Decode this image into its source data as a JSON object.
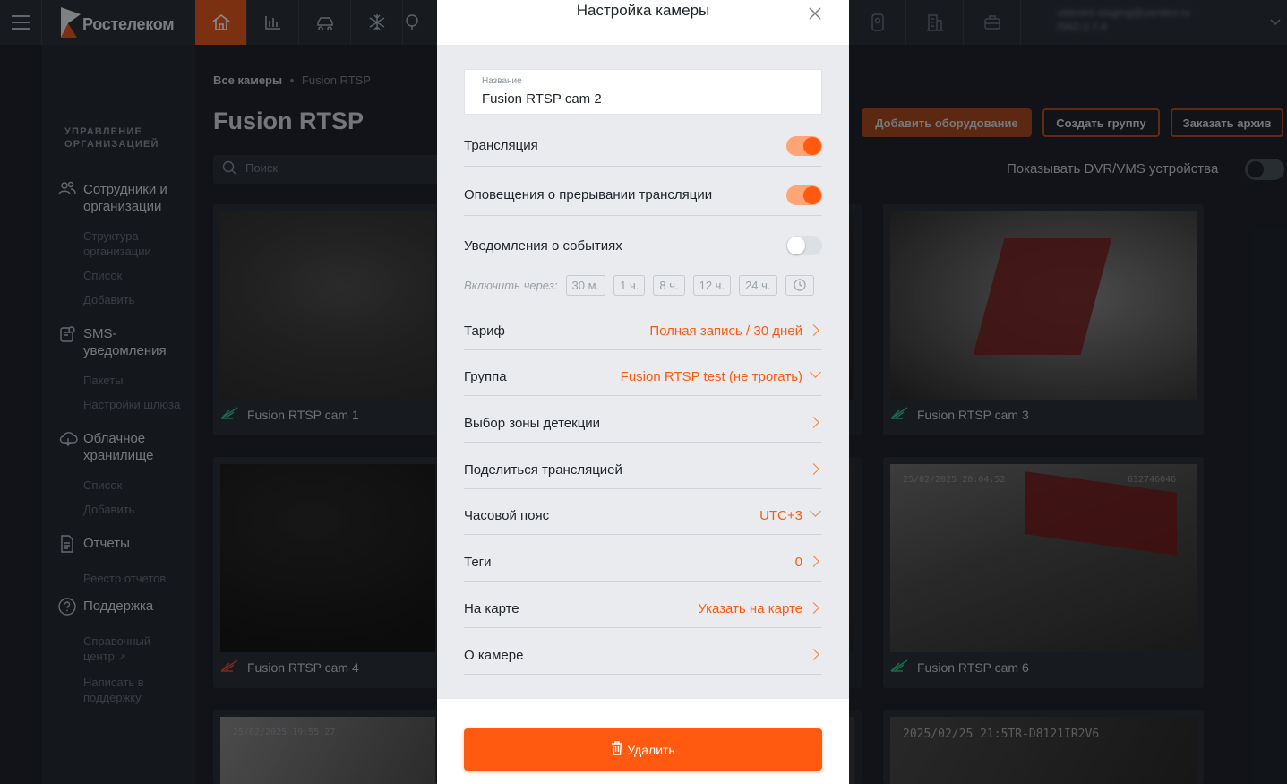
{
  "topbar": {
    "brand": "Ростелеком",
    "nav_icons": [
      "home-icon",
      "chart-icon",
      "car-icon",
      "snowflake-icon",
      "tree-icon"
    ],
    "nav_right_icons": [
      "doorbell-icon",
      "building-icon",
      "briefcase-icon"
    ],
    "user_email": "videoint-staging@yandex.ru",
    "user_sub": "ПАО 2.7.4"
  },
  "sidebar": {
    "section_title": "УПРАВЛЕНИЕ ОРГАНИЗАЦИЕЙ",
    "groups": [
      {
        "label": "Сотрудники и организации",
        "icon": "users-icon",
        "items": [
          "Структура организации",
          "Список",
          "Добавить"
        ]
      },
      {
        "label": "SMS-уведомления",
        "icon": "sms-icon",
        "items": [
          "Пакеты",
          "Настройки шлюза"
        ]
      },
      {
        "label": "Облачное хранилище",
        "icon": "cloud-icon",
        "items": [
          "Список",
          "Добавить"
        ]
      },
      {
        "label": "Отчеты",
        "icon": "report-icon",
        "items": [
          "Реестр отчетов"
        ]
      },
      {
        "label": "Поддержка",
        "icon": "help-icon",
        "items": [
          "Справочный центр",
          "Написать в поддержку"
        ]
      }
    ]
  },
  "main": {
    "breadcrumb_all": "Все камеры",
    "breadcrumb_current": "Fusion RTSP",
    "title": "Fusion RTSP",
    "search_placeholder": "Поиск",
    "buttons": {
      "add_equipment": "Добавить оборудование",
      "create_group": "Создать группу",
      "order_archive": "Заказать архив"
    },
    "dvr_label": "Показывать DVR/VMS устройства",
    "dvr_on": false,
    "cameras": [
      {
        "name": "Fusion RTSP cam 1",
        "status": "online"
      },
      {
        "name": "Fusion RTSP cam 3",
        "status": "online"
      },
      {
        "name": "Fusion RTSP cam 4",
        "status": "offline"
      },
      {
        "name": "Fusion RTSP cam 6",
        "status": "online"
      }
    ],
    "timestamps": {
      "cam6": "25/02/2025 20:04:52",
      "cam6_id": "632746046",
      "cam7": "25/02/2025 19:55:27",
      "cam9": "2025/02/25 21:5TR-D8121IR2V6"
    }
  },
  "modal": {
    "title": "Настройка камеры",
    "name_label": "Название",
    "name_value": "Fusion RTSP cam 2",
    "broadcast_label": "Трансляция",
    "broadcast_on": true,
    "interrupt_label": "Оповещения о прерывании трансляции",
    "interrupt_on": true,
    "events_label": "Уведомления о событиях",
    "events_on": false,
    "enable_via_label": "Включить через:",
    "enable_via_options": [
      "30 м.",
      "1 ч.",
      "8 ч.",
      "12 ч.",
      "24 ч."
    ],
    "tariff_label": "Тариф",
    "tariff_value": "Полная запись / 30 дней",
    "group_label": "Группа",
    "group_value": "Fusion RTSP test (не трогать)",
    "detection_label": "Выбор зоны детекции",
    "share_label": "Поделиться трансляцией",
    "timezone_label": "Часовой пояс",
    "timezone_value": "UTC+3",
    "tags_label": "Теги",
    "tags_value": "0",
    "map_label": "На карте",
    "map_value": "Указать на карте",
    "about_label": "О камере",
    "delete_label": "Удалить"
  },
  "colors": {
    "accent": "#ff5a10",
    "dark_bg": "#1f242c",
    "sidebar_bg": "#262c35",
    "online": "#2fc28a",
    "offline": "#e04a3a"
  }
}
